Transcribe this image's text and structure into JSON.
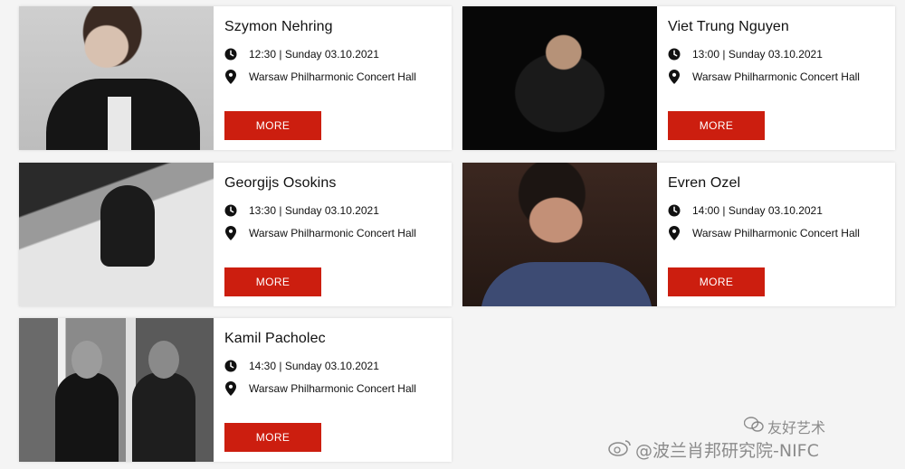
{
  "concerts": [
    {
      "name": "Szymon Nehring",
      "time": "12:30 | Sunday 03.10.2021",
      "venue": "Warsaw Philharmonic Concert Hall",
      "button": "MORE"
    },
    {
      "name": "Viet Trung Nguyen",
      "time": "13:00 | Sunday 03.10.2021",
      "venue": "Warsaw Philharmonic Concert Hall",
      "button": "MORE"
    },
    {
      "name": "Georgijs Osokins",
      "time": "13:30 | Sunday 03.10.2021",
      "venue": "Warsaw Philharmonic Concert Hall",
      "button": "MORE"
    },
    {
      "name": "Evren Ozel",
      "time": "14:00 | Sunday 03.10.2021",
      "venue": "Warsaw Philharmonic Concert Hall",
      "button": "MORE"
    },
    {
      "name": "Kamil Pacholec",
      "time": "14:30 | Sunday 03.10.2021",
      "venue": "Warsaw Philharmonic Concert Hall",
      "button": "MORE"
    }
  ],
  "icons": {
    "time": "clock-icon",
    "venue": "map-pin-icon"
  },
  "colors": {
    "button": "#cc1e0f",
    "card": "#ffffff",
    "background": "#f4f4f4"
  },
  "watermark": {
    "line1": "友好艺术",
    "line2": "@波兰肖邦研究院-NIFC"
  }
}
